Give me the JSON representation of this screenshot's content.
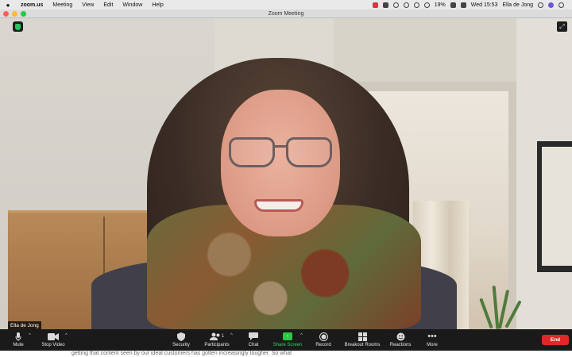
{
  "menubar": {
    "items": [
      "zoom.us",
      "Meeting",
      "View",
      "Edit",
      "Window",
      "Help"
    ],
    "battery": "19%",
    "clock": "Wed 15:53",
    "user": "Ella de Jong"
  },
  "window": {
    "title": "Zoom Meeting"
  },
  "video": {
    "participant_name": "Ella de Jong"
  },
  "toolbar": {
    "mute": "Mute",
    "stop_video": "Stop Video",
    "security": "Security",
    "participants": "Participants",
    "participants_count": "1",
    "chat": "Chat",
    "share_screen": "Share Screen",
    "record": "Record",
    "breakout_rooms": "Breakout Rooms",
    "reactions": "Reactions",
    "more": "More",
    "end": "End"
  },
  "background_page": {
    "text": "getting that content seen by our ideal customers has gotten increasingly tougher. So what"
  },
  "colors": {
    "share_accent": "#28c840",
    "end_button": "#e02828",
    "toolbar_bg": "#1a1a1a"
  }
}
